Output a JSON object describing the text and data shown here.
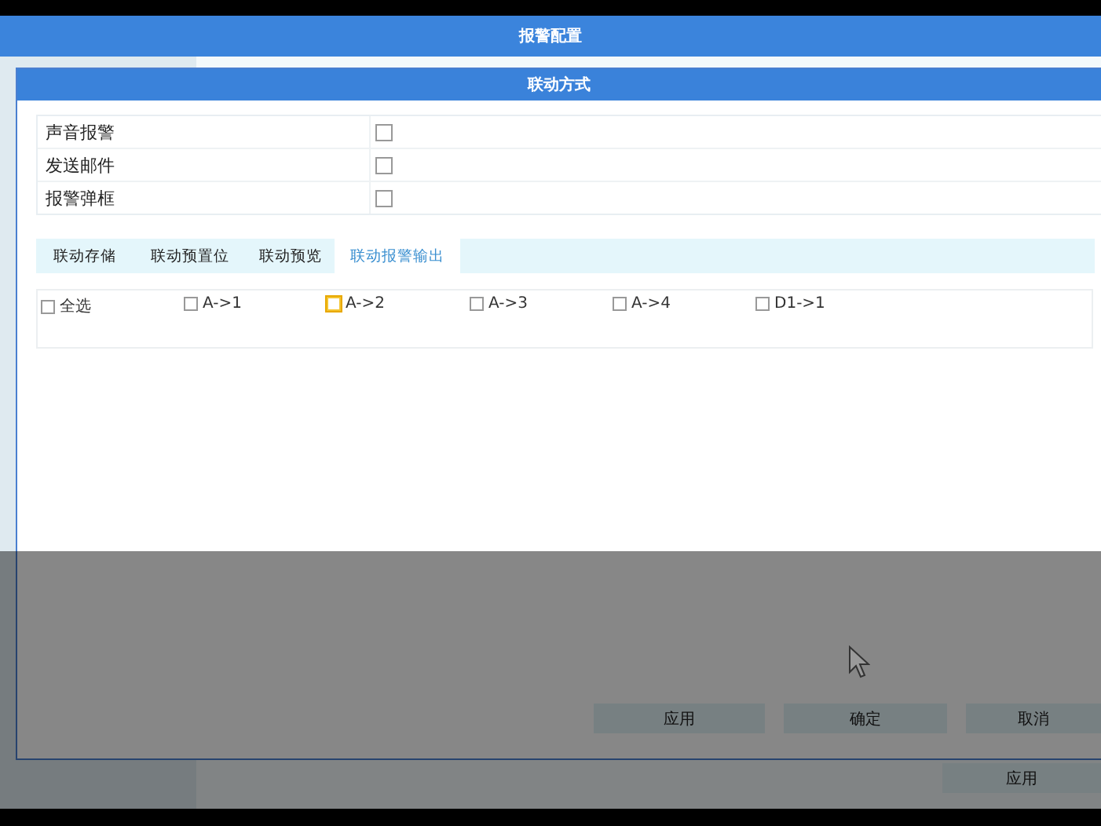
{
  "window": {
    "title": "报警配置"
  },
  "dialog": {
    "title": "联动方式",
    "settings": [
      {
        "label": "声音报警",
        "checked": false
      },
      {
        "label": "发送邮件",
        "checked": false
      },
      {
        "label": "报警弹框",
        "checked": false
      }
    ],
    "tabs": [
      {
        "label": "联动存储",
        "selected": false
      },
      {
        "label": "联动预置位",
        "selected": false
      },
      {
        "label": "联动预览",
        "selected": false
      },
      {
        "label": "联动报警输出",
        "selected": true
      }
    ],
    "outputs": [
      {
        "label": "全选",
        "checked": false,
        "focused": false
      },
      {
        "label": "A->1",
        "checked": false,
        "focused": false
      },
      {
        "label": "A->2",
        "checked": false,
        "focused": true
      },
      {
        "label": "A->3",
        "checked": false,
        "focused": false
      },
      {
        "label": "A->4",
        "checked": false,
        "focused": false
      },
      {
        "label": "D1->1",
        "checked": false,
        "focused": false
      }
    ],
    "buttons": [
      "应用",
      "确定",
      "取消"
    ]
  },
  "footer_button": "应用"
}
